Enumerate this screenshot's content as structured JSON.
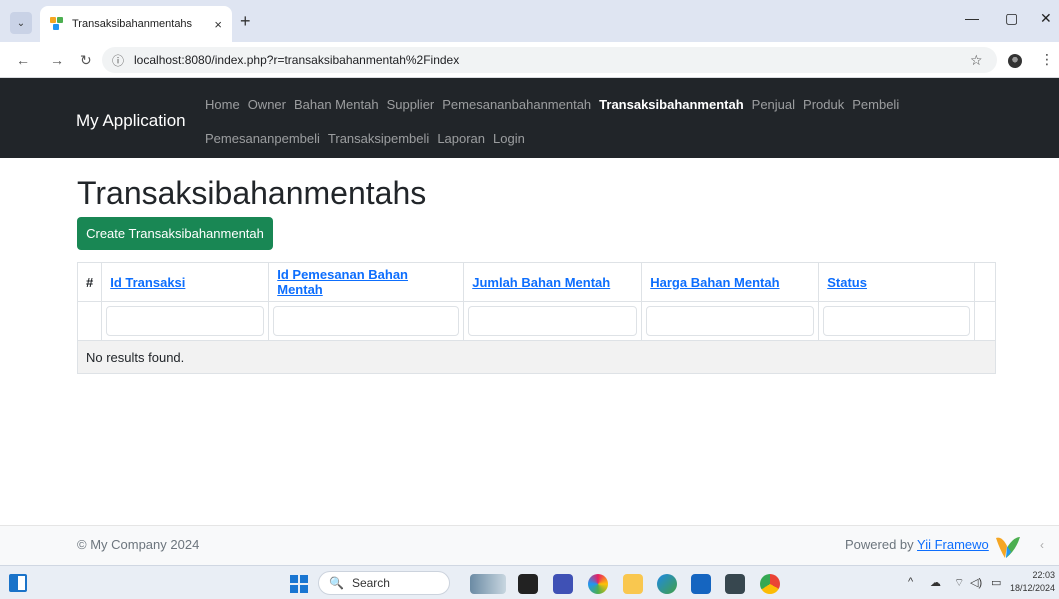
{
  "browser": {
    "tab_title": "Transaksibahanmentahs",
    "tab_close": "×",
    "new_tab": "+",
    "url": "localhost:8080/index.php?r=transaksibahanmentah%2Findex",
    "win_minimize": "—",
    "win_restore": "▢",
    "win_close": "✕",
    "back": "←",
    "forward": "→",
    "reload": "↻",
    "info": "ⓘ",
    "star": "☆",
    "kebab": "⋮",
    "tab_switch": "⌄"
  },
  "navbar": {
    "brand": "My Application",
    "row1": [
      "Home",
      "Owner",
      "Bahan Mentah",
      "Supplier",
      "Pemesananbahanmentah",
      "Transaksibahanmentah",
      "Penjual",
      "Produk",
      "Pembeli"
    ],
    "row2": [
      "Pemesananpembeli",
      "Transaksipembeli",
      "Laporan",
      "Login"
    ],
    "active": "Transaksibahanmentah"
  },
  "main": {
    "title": "Transaksibahanmentahs",
    "create_button": "Create Transaksibahanmentah",
    "table": {
      "headers": [
        "#",
        "Id Transaksi",
        "Id Pemesanan Bahan Mentah",
        "Jumlah Bahan Mentah",
        "Harga Bahan Mentah",
        "Status"
      ],
      "empty_message": "No results found."
    }
  },
  "footer": {
    "copyright": "© My Company 2024",
    "powered_prefix": "Powered by ",
    "powered_link": "Yii Framewo",
    "scroll_arrow": "‹"
  },
  "taskbar": {
    "search_label": "Search",
    "search_glyph": "🔍",
    "clock_time": "22:03",
    "clock_date": "18/12/2024",
    "tray_chevron": "^",
    "tray_cloud": "☁",
    "tray_wifi": "⌔",
    "tray_sound": "◁)",
    "tray_battery": "▭"
  },
  "colors": {
    "navbar_bg": "#212529",
    "create_button_bg": "#198754",
    "link": "#0d6efd"
  }
}
